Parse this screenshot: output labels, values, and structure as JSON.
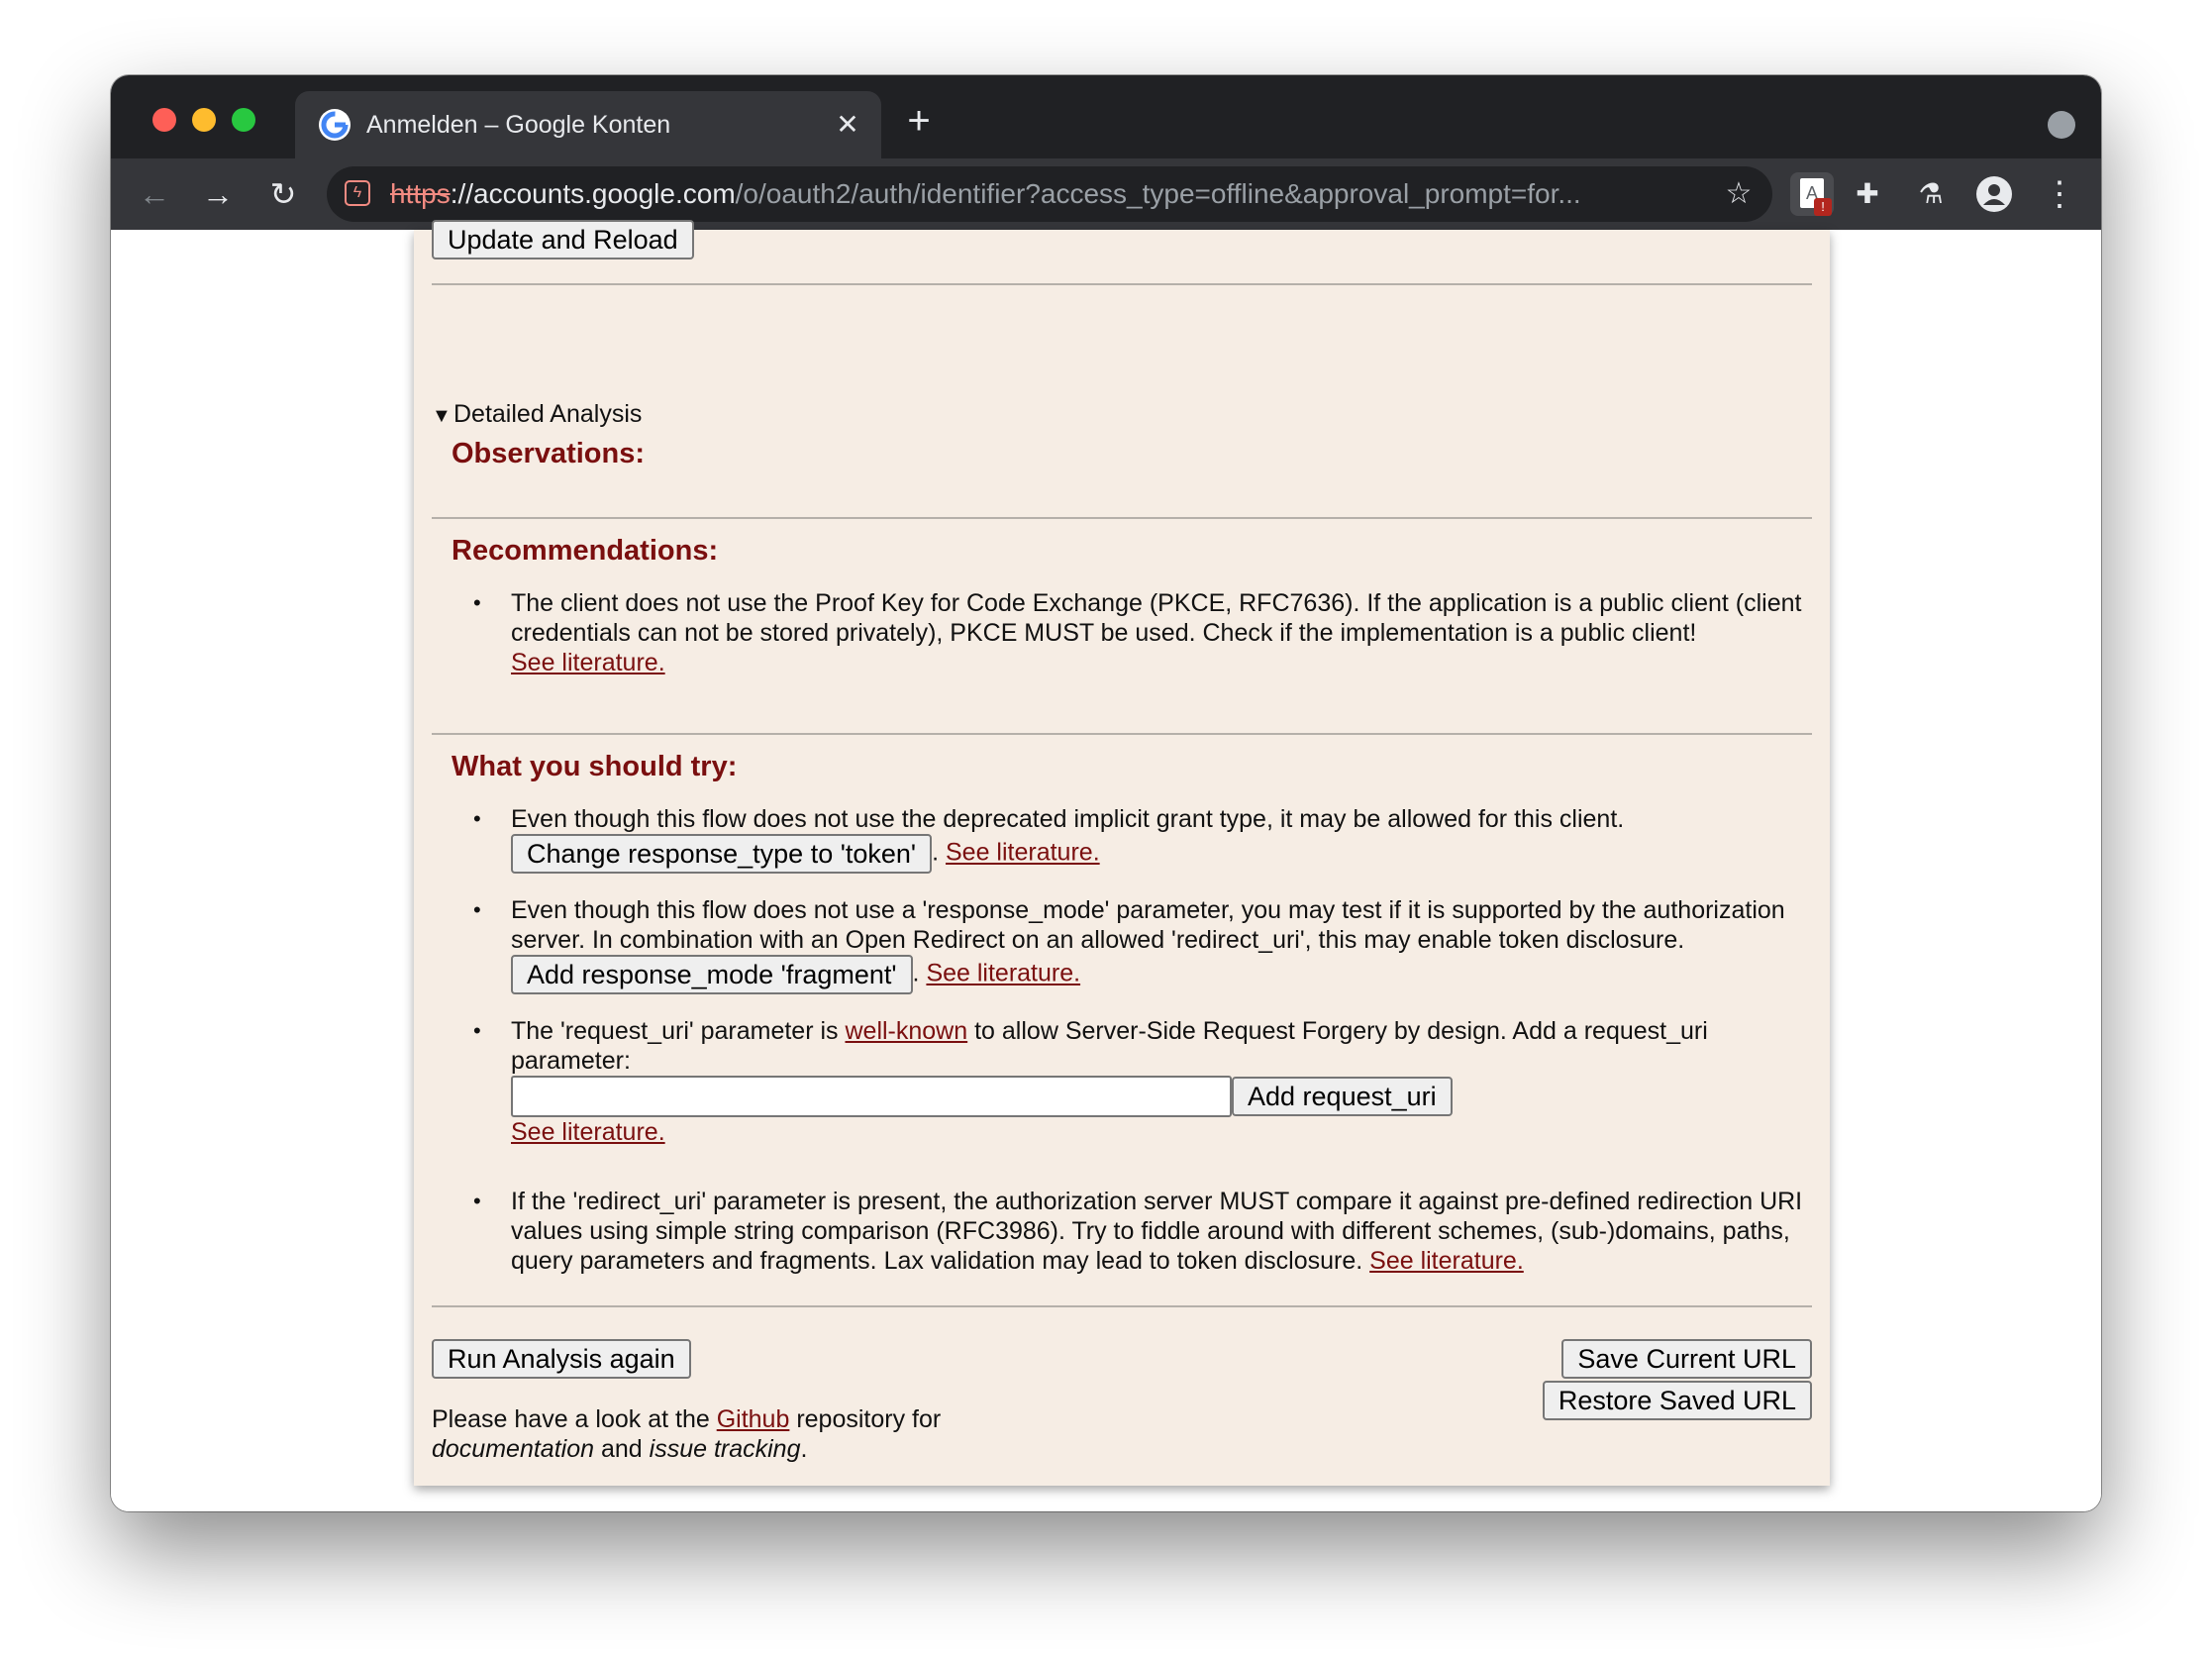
{
  "browser": {
    "tab_title": "Anmelden – Google Konten",
    "tab_close": "✕",
    "new_tab": "+",
    "url_scheme": "https",
    "url_host": "://accounts.google.com",
    "url_path": "/o/oauth2/auth/identifier?access_type=offline&approval_prompt=for...",
    "icons": {
      "back": "←",
      "forward": "→",
      "reload": "↻",
      "star": "☆",
      "puzzle": "✚",
      "flask": "⚗",
      "menu": "⋮",
      "ext_a": "A",
      "ext_badge": "!"
    }
  },
  "panel": {
    "update_reload_label": "Update and Reload",
    "detailed_analysis": "Detailed Analysis",
    "disclosure_glyph": "▼",
    "observations_heading": "Observations:",
    "recommendations_heading": "Recommendations:",
    "recommendations": [
      {
        "text": "The client does not use the Proof Key for Code Exchange (PKCE, RFC7636). If the application is a public client (client credentials can not be stored privately), PKCE MUST be used. Check if the implementation is a public client!",
        "link": "See literature."
      }
    ],
    "try_heading": "What you should try:",
    "try_items": {
      "implicit": {
        "text": "Even though this flow does not use the deprecated implicit grant type, it may be allowed for this client.",
        "button": "Change response_type to 'token'",
        "sep": ".",
        "link": "See literature."
      },
      "response_mode": {
        "text": "Even though this flow does not use a 'response_mode' parameter, you may test if it is supported by the authorization server. In combination with an Open Redirect on an allowed 'redirect_uri', this may enable token disclosure.",
        "button": "Add response_mode 'fragment'",
        "sep": ".",
        "link": "See literature."
      },
      "request_uri": {
        "text_before": "The 'request_uri' parameter is",
        "link_inline": "well-known",
        "text_after": "to allow Server-Side Request Forgery by design. Add a request_uri parameter:",
        "input_value": "",
        "button": "Add request_uri",
        "link": "See literature."
      },
      "redirect_uri": {
        "text": "If the 'redirect_uri' parameter is present, the authorization server MUST compare it against pre-defined redirection URI values using simple string comparison (RFC3986). Try to fiddle around with different schemes, (sub-)domains, paths, query parameters and fragments. Lax validation may lead to token disclosure.",
        "link": "See literature."
      }
    },
    "run_again_label": "Run Analysis again",
    "save_url_label": "Save Current URL",
    "restore_url_label": "Restore Saved URL",
    "footer": {
      "before": "Please have a look at the",
      "link": "Github",
      "after": "repository for",
      "doc": "documentation",
      "and": "and",
      "issue": "issue tracking",
      "end": "."
    }
  },
  "colors": {
    "panel_bg": "#f6ede4",
    "heading": "#7a0f0f",
    "link": "#7a0f0f",
    "chrome_dark": "#202124",
    "chrome_toolbar": "#35363a"
  }
}
